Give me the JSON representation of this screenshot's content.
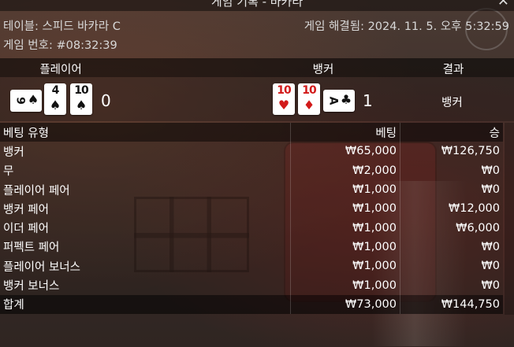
{
  "window": {
    "title": "게임 기록 - 바카라",
    "close_label": "✕"
  },
  "info": {
    "table_name": "테이블: 스피드 바카라 C",
    "resolved": "게임 해결됨: 2024. 11. 5. 오후 5:32:59",
    "game_no": "게임 번호: #08:32:39"
  },
  "columns": {
    "player": "플레이어",
    "banker": "뱅커",
    "result": "결과"
  },
  "player": {
    "cards": [
      {
        "rank": "9",
        "suit": "♠",
        "color": "black",
        "horizontal": true
      },
      {
        "rank": "4",
        "suit": "♠",
        "color": "black",
        "horizontal": false
      },
      {
        "rank": "10",
        "suit": "♠",
        "color": "black",
        "horizontal": false
      }
    ],
    "score": "0"
  },
  "banker": {
    "cards": [
      {
        "rank": "10",
        "suit": "♥",
        "color": "red",
        "horizontal": false
      },
      {
        "rank": "10",
        "suit": "♦",
        "color": "red",
        "horizontal": false
      },
      {
        "rank": "A",
        "suit": "♣",
        "color": "black",
        "horizontal": true
      }
    ],
    "score": "1"
  },
  "result": "뱅커",
  "bets": {
    "headers": {
      "type": "베팅 유형",
      "bet": "베팅",
      "win": "승"
    },
    "rows": [
      {
        "type": "뱅커",
        "bet": "₩65,000",
        "win": "₩126,750"
      },
      {
        "type": "무",
        "bet": "₩2,000",
        "win": "₩0"
      },
      {
        "type": "플레이어 페어",
        "bet": "₩1,000",
        "win": "₩0"
      },
      {
        "type": "뱅커 페어",
        "bet": "₩1,000",
        "win": "₩12,000"
      },
      {
        "type": "이더 페어",
        "bet": "₩1,000",
        "win": "₩6,000"
      },
      {
        "type": "퍼펙트 페어",
        "bet": "₩1,000",
        "win": "₩0"
      },
      {
        "type": "플레이어 보너스",
        "bet": "₩1,000",
        "win": "₩0"
      },
      {
        "type": "뱅커 보너스",
        "bet": "₩1,000",
        "win": "₩0"
      }
    ],
    "total": {
      "type": "합계",
      "bet": "₩73,000",
      "win": "₩144,750"
    }
  }
}
